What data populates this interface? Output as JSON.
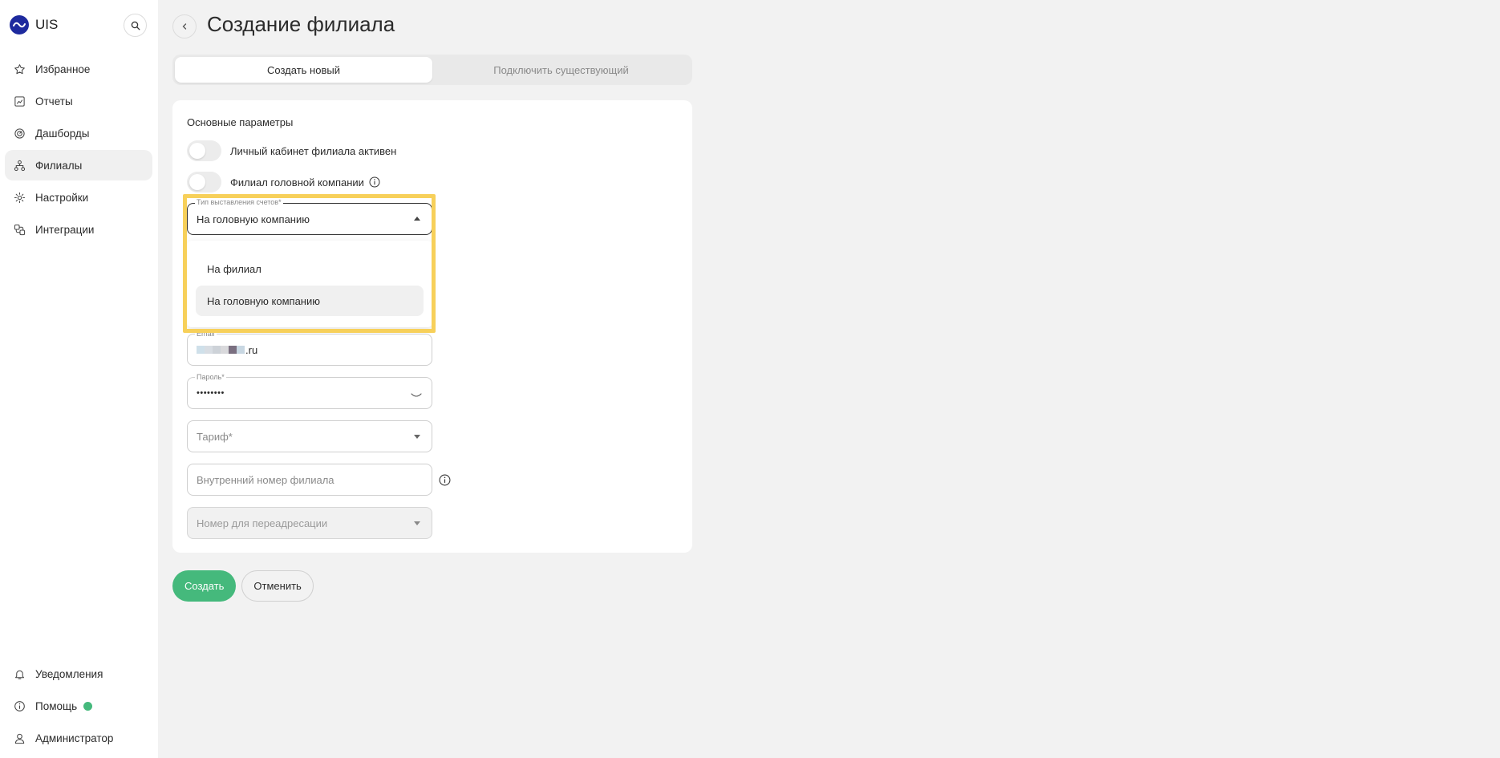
{
  "app": {
    "name": "UIS"
  },
  "sidebar": {
    "items": [
      {
        "label": "Избранное",
        "icon": "star-icon"
      },
      {
        "label": "Отчеты",
        "icon": "report-icon"
      },
      {
        "label": "Дашборды",
        "icon": "dashboard-icon"
      },
      {
        "label": "Филиалы",
        "icon": "branches-icon",
        "active": true
      },
      {
        "label": "Настройки",
        "icon": "gear-icon"
      },
      {
        "label": "Интеграции",
        "icon": "integrations-icon"
      }
    ],
    "bottom": [
      {
        "label": "Уведомления",
        "icon": "bell-icon"
      },
      {
        "label": "Помощь",
        "icon": "info-icon"
      },
      {
        "label": "Администратор",
        "icon": "user-icon"
      }
    ]
  },
  "page": {
    "title": "Создание филиала"
  },
  "tabs": [
    {
      "label": "Создать новый",
      "active": true
    },
    {
      "label": "Подключить существующий",
      "active": false
    }
  ],
  "form": {
    "section_title": "Основные параметры",
    "toggle_active": {
      "label": "Личный кабинет филиала активен",
      "on": false
    },
    "toggle_head": {
      "label": "Филиал головной компании",
      "on": false
    },
    "billing_type": {
      "label": "Тип выставления счетов*",
      "value": "На головную компанию",
      "options": [
        "На филиал",
        "На головную компанию"
      ]
    },
    "email": {
      "label": "Email",
      "value_suffix": ".ru"
    },
    "password": {
      "label": "Пароль*",
      "value": "••••••••"
    },
    "tariff": {
      "placeholder": "Тариф*"
    },
    "internal_number": {
      "placeholder": "Внутренний номер филиала"
    },
    "redirect_number": {
      "placeholder": "Номер для переадресации"
    }
  },
  "actions": {
    "create": "Создать",
    "cancel": "Отменить"
  },
  "colors": {
    "accent": "#45b97c",
    "highlight": "#f7d05a",
    "logo": "#1e2a9e"
  }
}
